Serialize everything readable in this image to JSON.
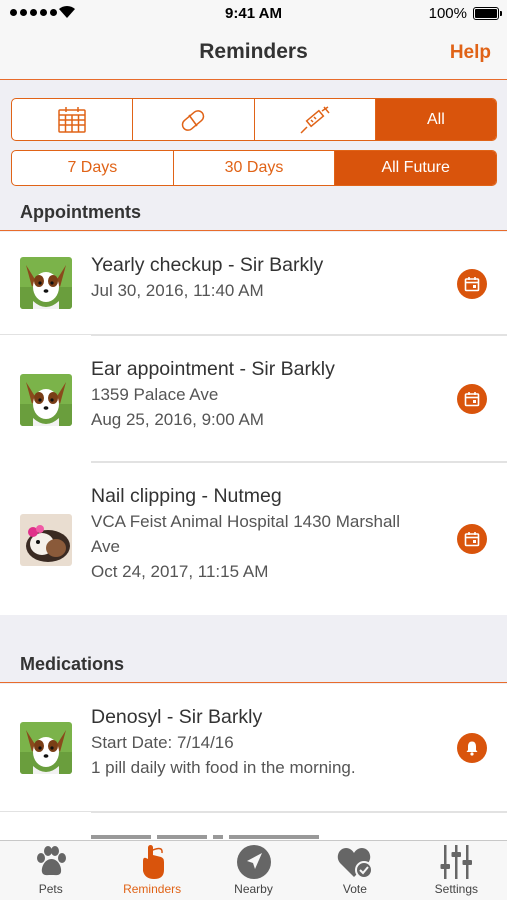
{
  "status_bar": {
    "time": "9:41 AM",
    "battery": "100%"
  },
  "nav": {
    "title": "Reminders",
    "help": "Help"
  },
  "type_filter": {
    "items": [
      {
        "icon": "calendar-icon"
      },
      {
        "icon": "pill-icon"
      },
      {
        "icon": "syringe-icon"
      },
      {
        "label": "All",
        "active": true
      }
    ]
  },
  "range_filter": {
    "items": [
      {
        "label": "7 Days"
      },
      {
        "label": "30 Days"
      },
      {
        "label": "All Future",
        "active": true
      }
    ]
  },
  "appointments": {
    "header": "Appointments",
    "items": [
      {
        "title": "Yearly checkup - Sir Barkly",
        "lines": [
          "Jul 30, 2016, 11:40 AM"
        ],
        "pet": "dog",
        "action_icon": "calendar-icon"
      },
      {
        "title": "Ear appointment - Sir Barkly",
        "lines": [
          "1359 Palace Ave",
          "Aug 25, 2016, 9:00 AM"
        ],
        "pet": "dog",
        "action_icon": "calendar-icon"
      },
      {
        "title": "Nail clipping - Nutmeg",
        "lines": [
          "VCA Feist Animal Hospital 1430 Marshall",
          "Ave",
          "Oct 24, 2017, 11:15 AM"
        ],
        "pet": "guinea-pig",
        "action_icon": "calendar-icon"
      }
    ]
  },
  "medications": {
    "header": "Medications",
    "items": [
      {
        "title": "Denosyl - Sir Barkly",
        "lines": [
          "Start Date: 7/14/16",
          "1 pill daily with food in the morning."
        ],
        "pet": "dog",
        "action_icon": "bell-icon"
      }
    ]
  },
  "tabs": [
    {
      "label": "Pets",
      "icon": "paw-icon"
    },
    {
      "label": "Reminders",
      "icon": "finger-reminder-icon",
      "active": true
    },
    {
      "label": "Nearby",
      "icon": "location-arrow-icon"
    },
    {
      "label": "Vote",
      "icon": "heart-check-icon"
    },
    {
      "label": "Settings",
      "icon": "sliders-icon"
    }
  ],
  "colors": {
    "accent": "#d9540c",
    "accent_text": "#e06317",
    "background": "#efeff4"
  }
}
